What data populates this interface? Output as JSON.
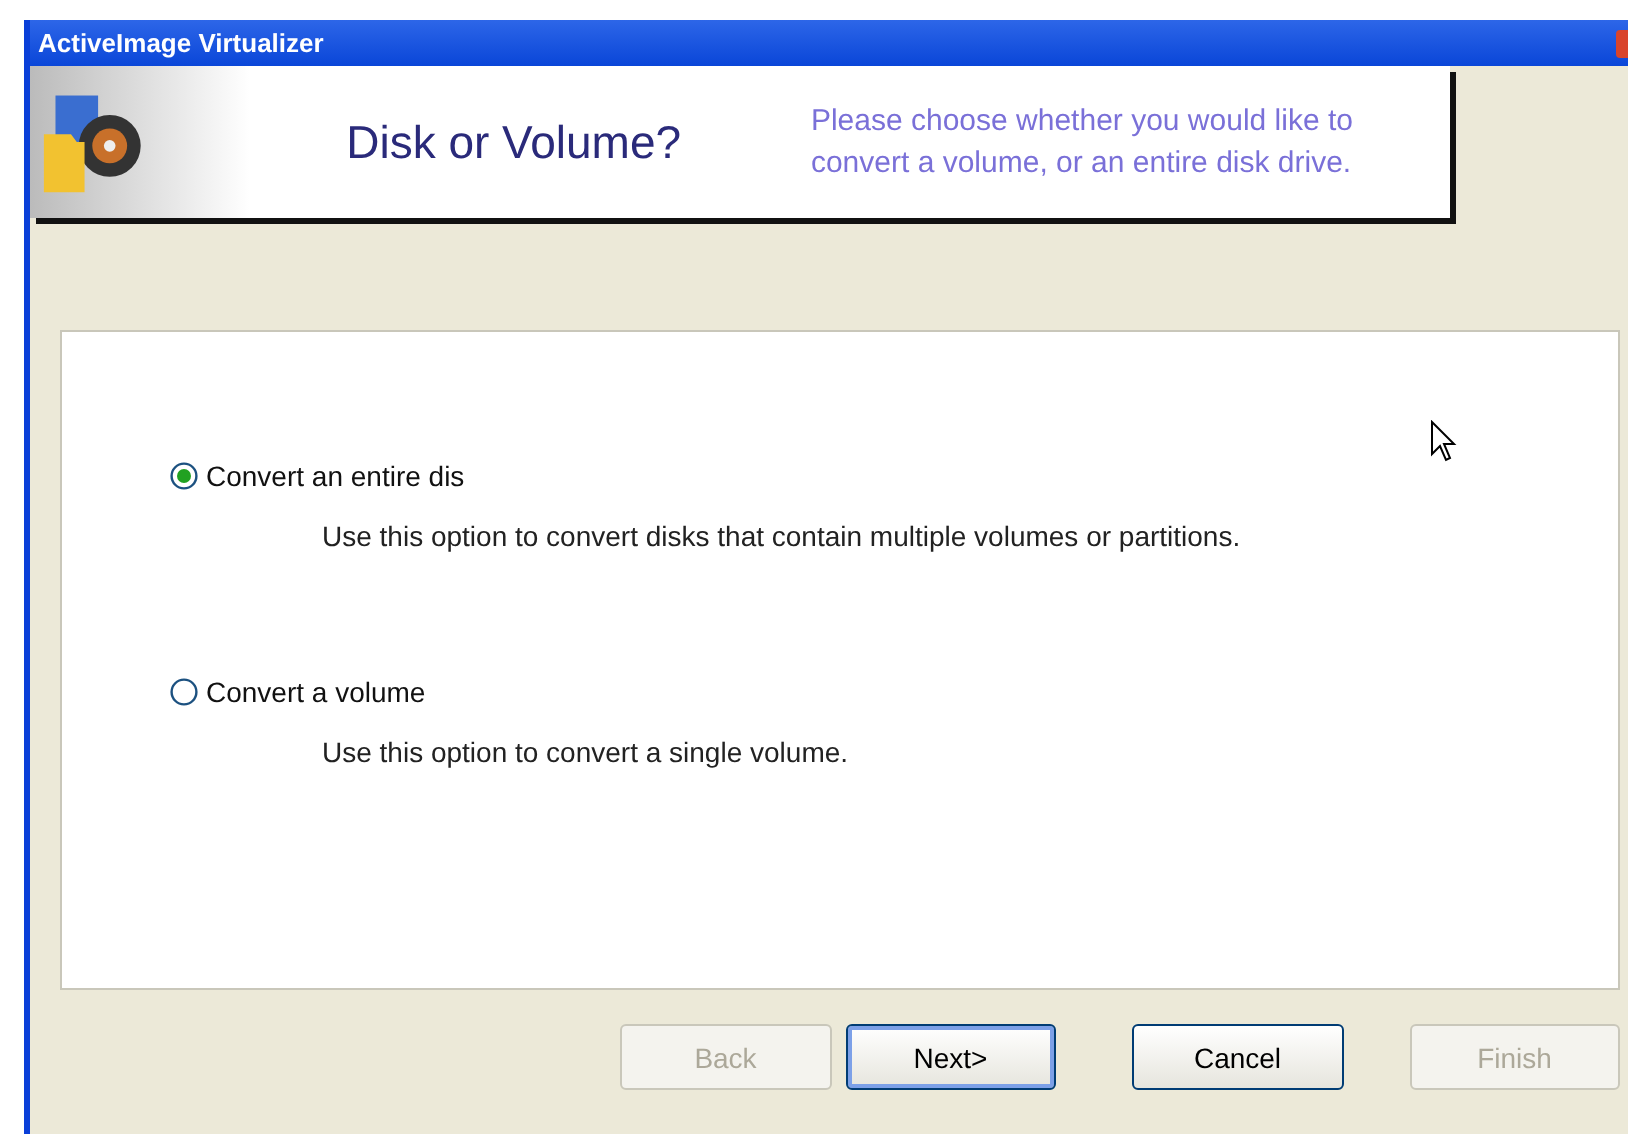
{
  "window": {
    "title": "ActiveImage Virtualizer"
  },
  "header": {
    "title": "Disk or Volume?",
    "description": "Please choose whether you would like to convert a volume, or an entire disk drive."
  },
  "options": [
    {
      "label": "Convert an entire dis",
      "description": "Use this option to convert disks that contain multiple volumes or partitions.",
      "selected": true
    },
    {
      "label": "Convert a volume",
      "description": "Use this option to convert a single volume.",
      "selected": false
    }
  ],
  "buttons": [
    {
      "label": "Back",
      "disabled": true,
      "default": false
    },
    {
      "label": "Next>",
      "disabled": false,
      "default": true
    },
    {
      "label": "Cancel",
      "disabled": false,
      "default": false
    },
    {
      "label": "Finish",
      "disabled": true,
      "default": false
    }
  ]
}
